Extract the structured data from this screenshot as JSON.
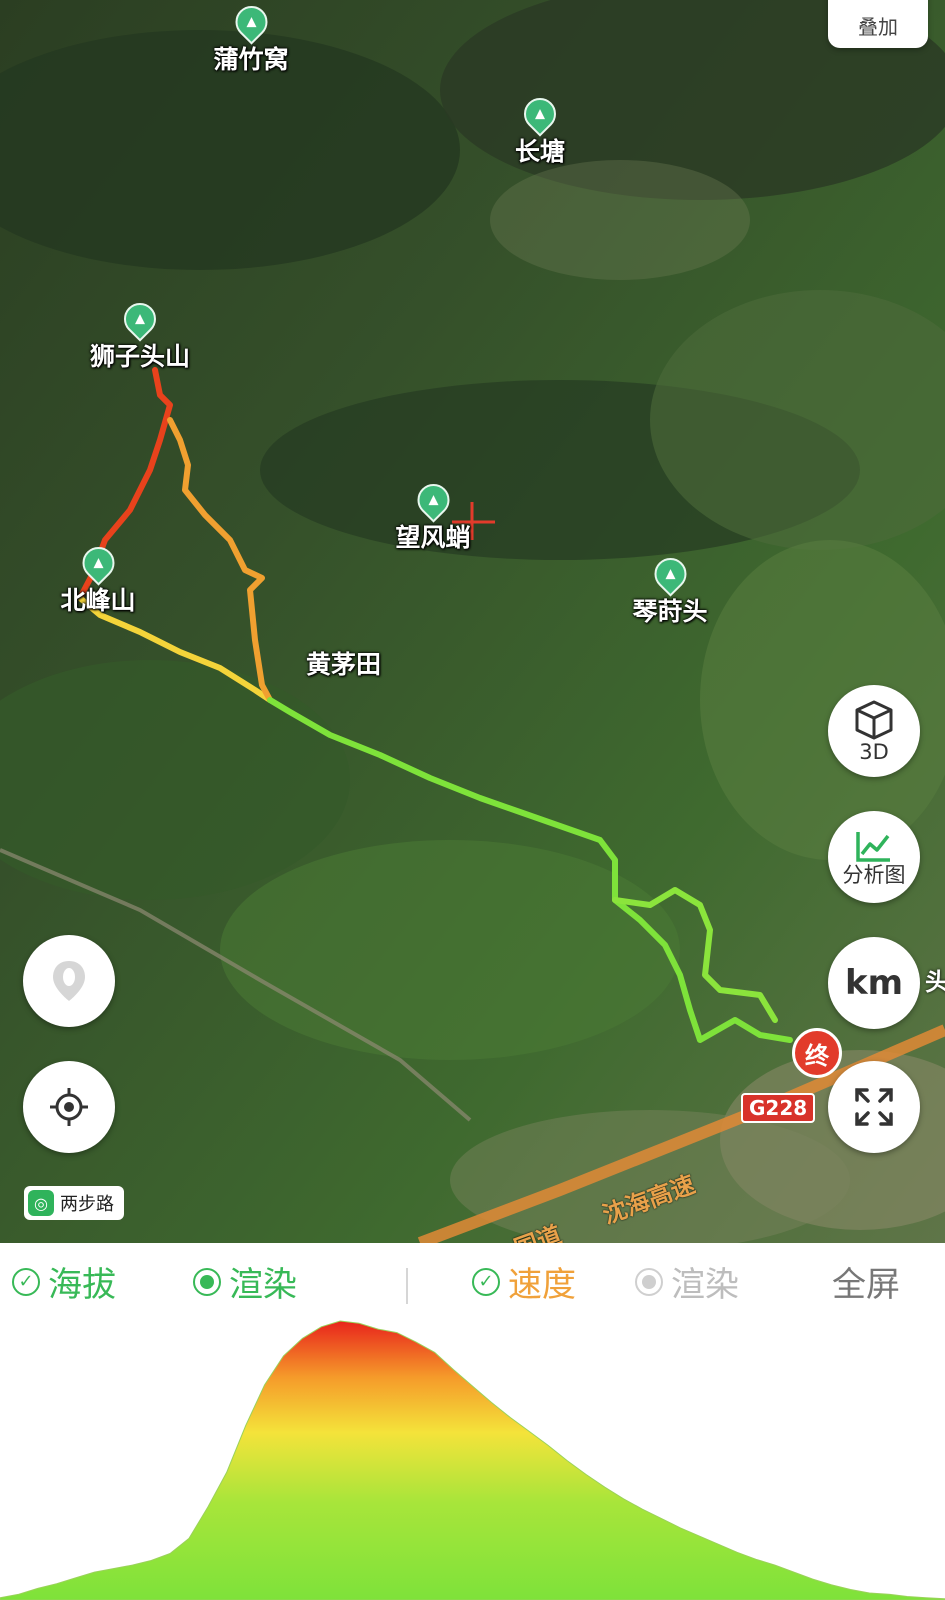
{
  "map": {
    "overlay_button": "叠加",
    "poi": [
      {
        "name": "蒲竹窝"
      },
      {
        "name": "长塘"
      },
      {
        "name": "狮子头山"
      },
      {
        "name": "望风蛸"
      },
      {
        "name": "北峰山"
      },
      {
        "name": "琴莳头"
      }
    ],
    "place_label": "黄茅田",
    "edge_label": "头",
    "end_marker": "终",
    "road_sign": "G228",
    "road_name": "沈海高速",
    "road_name_2": "国道",
    "brand": "两步路",
    "track_colors": {
      "low_speed": "#7ee23a",
      "mid_speed": "#f4e33a",
      "high_speed": "#e8241c"
    }
  },
  "controls": {
    "btn_3d": "3D",
    "btn_analysis": "分析图",
    "btn_km": "km",
    "icons": [
      "footprint-icon",
      "locate-icon",
      "cube-icon",
      "chart-line-icon",
      "fullscreen-icon"
    ]
  },
  "toolbar": {
    "altitude_label": "海拔",
    "altitude_render_label": "渲染",
    "speed_label": "速度",
    "speed_render_label": "渲染",
    "fullscreen_label": "全屏",
    "colors": {
      "active": "#38b957",
      "speed_text": "#f0a13a",
      "inactive": "#bdbdbd"
    }
  },
  "chart_data": {
    "type": "area",
    "title": "",
    "xlabel": "",
    "ylabel": "",
    "gradient": [
      "#7ee23a",
      "#f4e33a",
      "#e8241c"
    ],
    "x": [
      0,
      2,
      4,
      6,
      8,
      10,
      12,
      14,
      16,
      18,
      20,
      22,
      24,
      26,
      28,
      30,
      32,
      34,
      36,
      38,
      40,
      42,
      44,
      46,
      48,
      50,
      52,
      54,
      56,
      58,
      60,
      62,
      64,
      66,
      68,
      70,
      72,
      74,
      76,
      78,
      80,
      82,
      84,
      86,
      88,
      90,
      92,
      94,
      96,
      98,
      100
    ],
    "values": [
      2,
      5,
      10,
      14,
      19,
      24,
      27,
      30,
      34,
      40,
      53,
      80,
      110,
      150,
      185,
      210,
      225,
      235,
      240,
      238,
      233,
      230,
      222,
      213,
      198,
      184,
      170,
      157,
      145,
      133,
      120,
      108,
      97,
      87,
      78,
      70,
      62,
      55,
      48,
      41,
      35,
      30,
      24,
      18,
      13,
      9,
      6,
      5,
      3,
      2,
      1
    ]
  }
}
